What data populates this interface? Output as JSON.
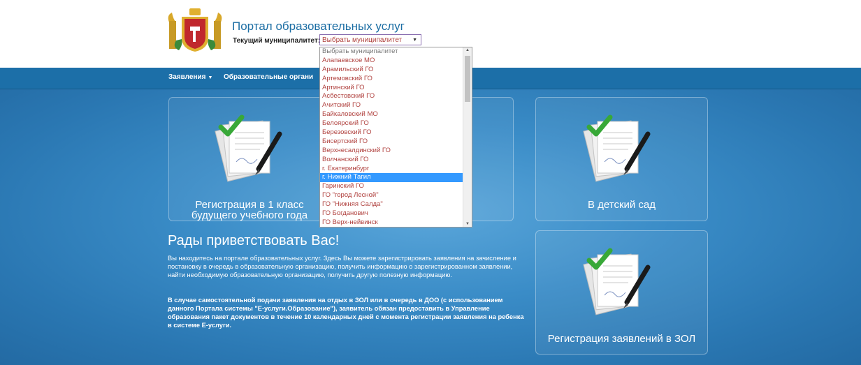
{
  "header": {
    "title": "Портал образовательных услуг",
    "municipality_label": "Текущий муниципалитет:",
    "municipality_select": "Выбрать муниципалитет"
  },
  "nav": {
    "items": [
      {
        "label": "Заявления"
      },
      {
        "label": "Образовательные органи"
      }
    ]
  },
  "tiles": {
    "school": {
      "line1": "Регистрация в 1 класс",
      "line2": "будущего учебного года"
    },
    "kindergarten": {
      "label": "В детский сад"
    },
    "camp": {
      "label": "Регистрация заявлений в ЗОЛ"
    }
  },
  "welcome": {
    "title": "Рады приветствовать Вас!",
    "text": "Вы находитесь на портале образовательных услуг. Здесь Вы можете зарегистрировать заявления на зачисление и постановку в очередь в образовательную организацию, получить информацию о зарегистрированном заявлении, найти необходимую образовательную организацию, получить другую полезную информацию.",
    "notice": "В случае самостоятельной подачи заявления на отдых в ЗОЛ или в очередь в ДОО (с использованием данного Портала системы \"Е-услуги.Образование\"), заявитель обязан предоставить в Управление образования пакет документов в течение 10 календарных дней с момента регистрации заявления на ребенка в системе Е-услуги."
  },
  "dropdown": {
    "options": [
      "Выбрать муниципалитет",
      "Алапаевское МО",
      "Арамильский ГО",
      "Артемовский ГО",
      "Артинский ГО",
      "Асбестовский ГО",
      "Ачитский ГО",
      "Байкаловский МО",
      "Белоярский ГО",
      "Березовский ГО",
      "Бисертский ГО",
      "Верхнесалдинский ГО",
      "Волчанский ГО",
      "г. Екатеринбург",
      "г. Нижний Тагил",
      "Гаринский ГО",
      "ГО \"город Лесной\"",
      "ГО \"Нижняя Салда\"",
      "ГО Богданович",
      "ГО Верх-нейвинск"
    ],
    "selected_index": 14
  },
  "colors": {
    "nav_bg": "#1c6fa8",
    "main_bg": "#3a8cc7",
    "title_blue": "#1c6ea4",
    "option_red": "#b0413e",
    "selected_bg": "#3399ff"
  }
}
